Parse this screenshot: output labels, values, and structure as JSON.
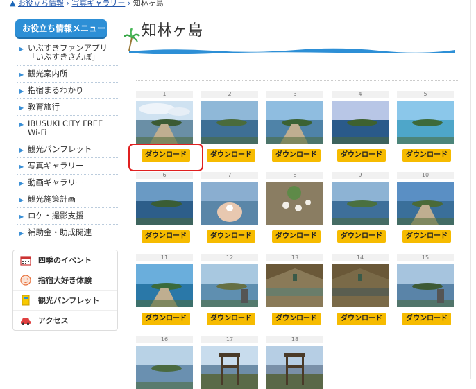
{
  "breadcrumb": {
    "home_icon": "home-icon",
    "item1": "お役立ち情報",
    "sep": "›",
    "item2": "写真ギャラリー",
    "current": "知林ヶ島"
  },
  "sidebar": {
    "header": "お役立ち情報メニュー",
    "items": [
      {
        "label": "いぶすきファンアプリ「いぶすきさんぽ」"
      },
      {
        "label": "観光案内所"
      },
      {
        "label": "指宿まるわかり"
      },
      {
        "label": "教育旅行"
      },
      {
        "label": "IBUSUKI CITY FREE Wi-Fi"
      },
      {
        "label": "観光パンフレット"
      },
      {
        "label": "写真ギャラリー"
      },
      {
        "label": "動画ギャラリー"
      },
      {
        "label": "観光施策計画"
      },
      {
        "label": "ロケ・撮影支援"
      },
      {
        "label": "補助金・助成関連"
      }
    ],
    "links": [
      {
        "label": "四季のイベント",
        "icon": "calendar-icon"
      },
      {
        "label": "指宿大好き体験",
        "icon": "smile-icon"
      },
      {
        "label": "観光パンフレット",
        "icon": "brochure-icon"
      },
      {
        "label": "アクセス",
        "icon": "car-icon"
      }
    ]
  },
  "main": {
    "title": "知林ヶ島"
  },
  "gallery": {
    "download_label": "ダウンロード",
    "photos": [
      {
        "num": "1"
      },
      {
        "num": "2"
      },
      {
        "num": "3"
      },
      {
        "num": "4"
      },
      {
        "num": "5"
      },
      {
        "num": "6"
      },
      {
        "num": "7"
      },
      {
        "num": "8"
      },
      {
        "num": "9"
      },
      {
        "num": "10"
      },
      {
        "num": "11"
      },
      {
        "num": "12"
      },
      {
        "num": "13"
      },
      {
        "num": "14"
      },
      {
        "num": "15"
      },
      {
        "num": "16"
      },
      {
        "num": "17"
      },
      {
        "num": "18"
      }
    ]
  },
  "colors": {
    "accent": "#2d8fd6",
    "download": "#f6bb00",
    "highlight": "#e02020"
  }
}
